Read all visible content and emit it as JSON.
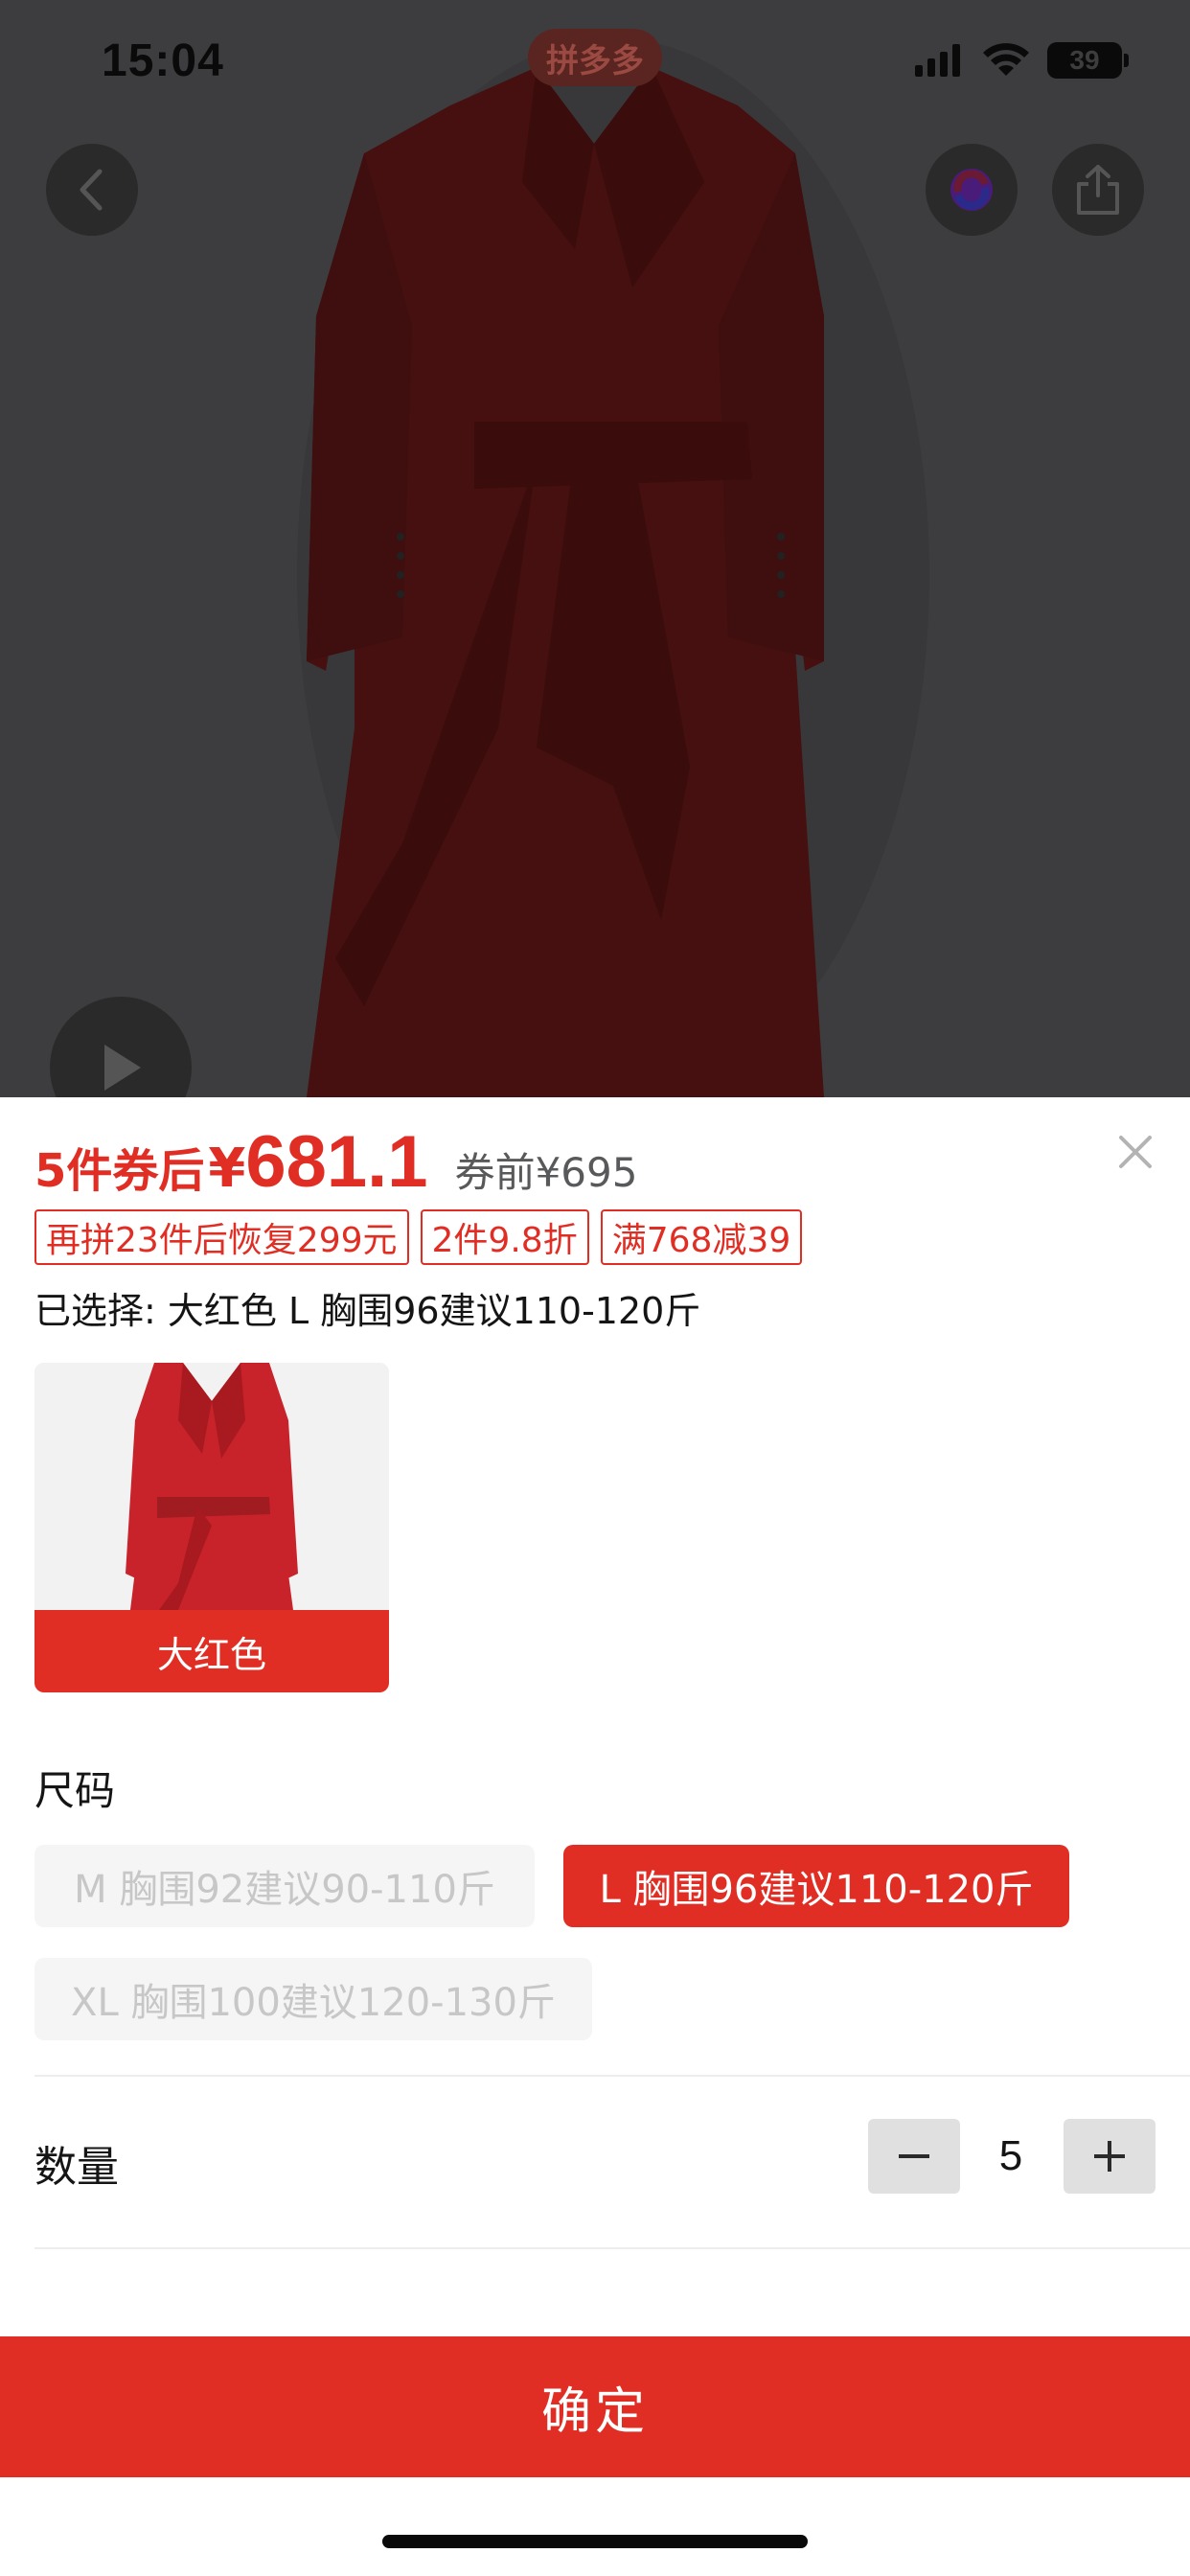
{
  "status_bar": {
    "time": "15:04",
    "app_badge": "拼多多",
    "battery": "39"
  },
  "price": {
    "prefix": "5件券后",
    "currency": "¥",
    "value": "681.1",
    "before_label": "券前¥695"
  },
  "promo_tags": [
    "再拼23件后恢复299元",
    "2件9.8折",
    "满768减39"
  ],
  "selection": {
    "text": "已选择: 大红色 L 胸围96建议110-120斤"
  },
  "color_options": [
    {
      "label": "大红色",
      "selected": true
    }
  ],
  "size": {
    "title": "尺码",
    "options": [
      {
        "label": "M 胸围92建议90-110斤",
        "state": "disabled"
      },
      {
        "label": "L 胸围96建议110-120斤",
        "state": "selected"
      },
      {
        "label": "XL 胸围100建议120-130斤",
        "state": "disabled"
      }
    ]
  },
  "quantity": {
    "title": "数量",
    "value": "5"
  },
  "confirm_label": "确定",
  "icons": {
    "back": "back-arrow-icon",
    "share": "share-icon",
    "assistant": "assistant-icon",
    "play": "play-icon",
    "close": "close-icon",
    "minus": "minus-icon",
    "plus": "plus-icon"
  },
  "colors": {
    "accent": "#e02e24",
    "overlay": "#3d3d3f",
    "coat": "#4a0d0f"
  }
}
